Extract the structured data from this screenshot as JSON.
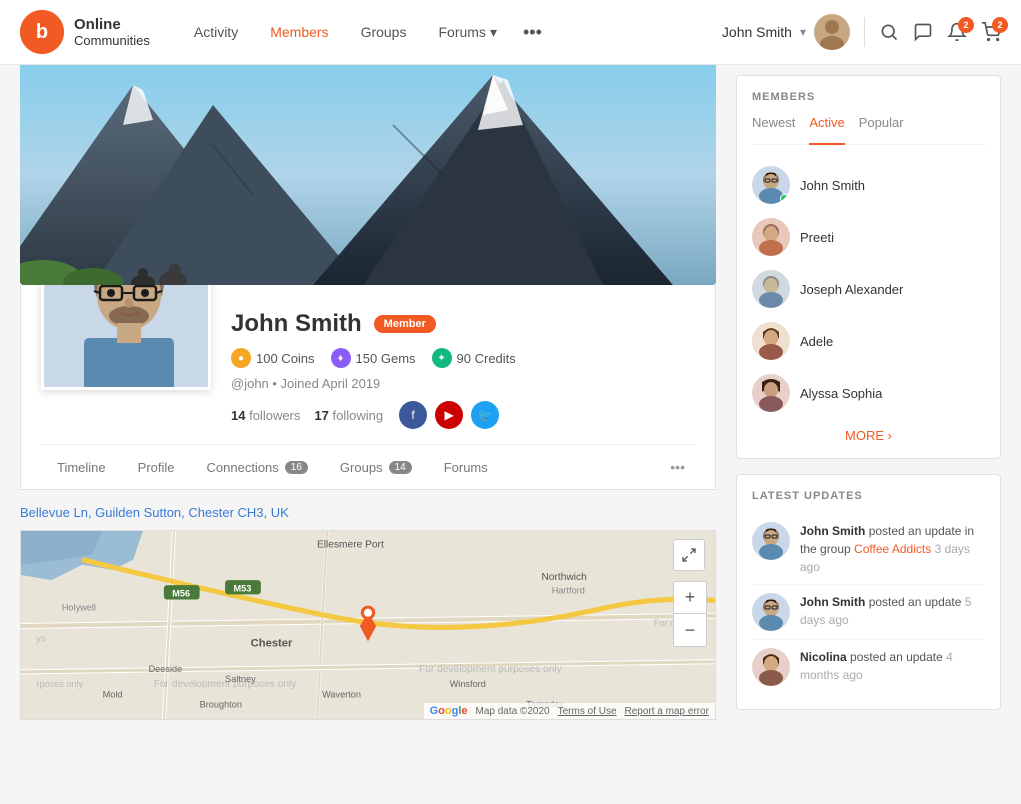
{
  "header": {
    "logo_text1": "Online",
    "logo_text2": "Communities",
    "logo_letter": "b",
    "nav": [
      {
        "label": "Activity",
        "id": "activity",
        "active": false
      },
      {
        "label": "Members",
        "id": "members",
        "active": true
      },
      {
        "label": "Groups",
        "id": "groups",
        "active": false
      },
      {
        "label": "Forums",
        "id": "forums",
        "active": false,
        "has_dropdown": true
      }
    ],
    "user_name": "John Smith",
    "notifications_count": "2",
    "cart_count": "2"
  },
  "profile": {
    "name": "John Smith",
    "badge": "Member",
    "coins_label": "100 Coins",
    "gems_label": "150 Gems",
    "credits_label": "90 Credits",
    "join_info": "@john • Joined April 2019",
    "followers_count": "14",
    "followers_label": "followers",
    "following_count": "17",
    "following_label": "following"
  },
  "profile_tabs": [
    {
      "label": "Timeline",
      "count": null
    },
    {
      "label": "Profile",
      "count": null
    },
    {
      "label": "Connections",
      "count": "16"
    },
    {
      "label": "Groups",
      "count": "14"
    },
    {
      "label": "Forums",
      "count": null
    }
  ],
  "location": {
    "text": "Bellevue Ln, Guilden Sutton, Chester CH3, UK"
  },
  "map": {
    "expand_label": "⛶",
    "zoom_in": "+",
    "zoom_out": "−",
    "footer_map_data": "Map data ©2020",
    "footer_terms": "Terms of Use",
    "footer_error": "Report a map error"
  },
  "members_section": {
    "title": "MEMBERS",
    "tabs": [
      {
        "label": "Newest",
        "active": false
      },
      {
        "label": "Active",
        "active": true
      },
      {
        "label": "Popular",
        "active": false
      }
    ],
    "members": [
      {
        "name": "John Smith",
        "online": true,
        "id": "john"
      },
      {
        "name": "Preeti",
        "online": false,
        "id": "preeti"
      },
      {
        "name": "Joseph Alexander",
        "online": false,
        "id": "joseph"
      },
      {
        "name": "Adele",
        "online": false,
        "id": "adele"
      },
      {
        "name": "Alyssa Sophia",
        "online": false,
        "id": "alyssa"
      }
    ],
    "more_label": "MORE ›"
  },
  "latest_updates": {
    "title": "LATEST UPDATES",
    "updates": [
      {
        "author": "John Smith",
        "action": " posted an update in the group ",
        "group": "Coffee Addicts",
        "time": " 3 days ago",
        "id": "john"
      },
      {
        "author": "John Smith",
        "action": " posted an update ",
        "group": "",
        "time": "5 days ago",
        "id": "john"
      },
      {
        "author": "Nicolina",
        "action": " posted an update ",
        "group": "",
        "time": "4 months ago",
        "id": "nicolina"
      }
    ]
  }
}
